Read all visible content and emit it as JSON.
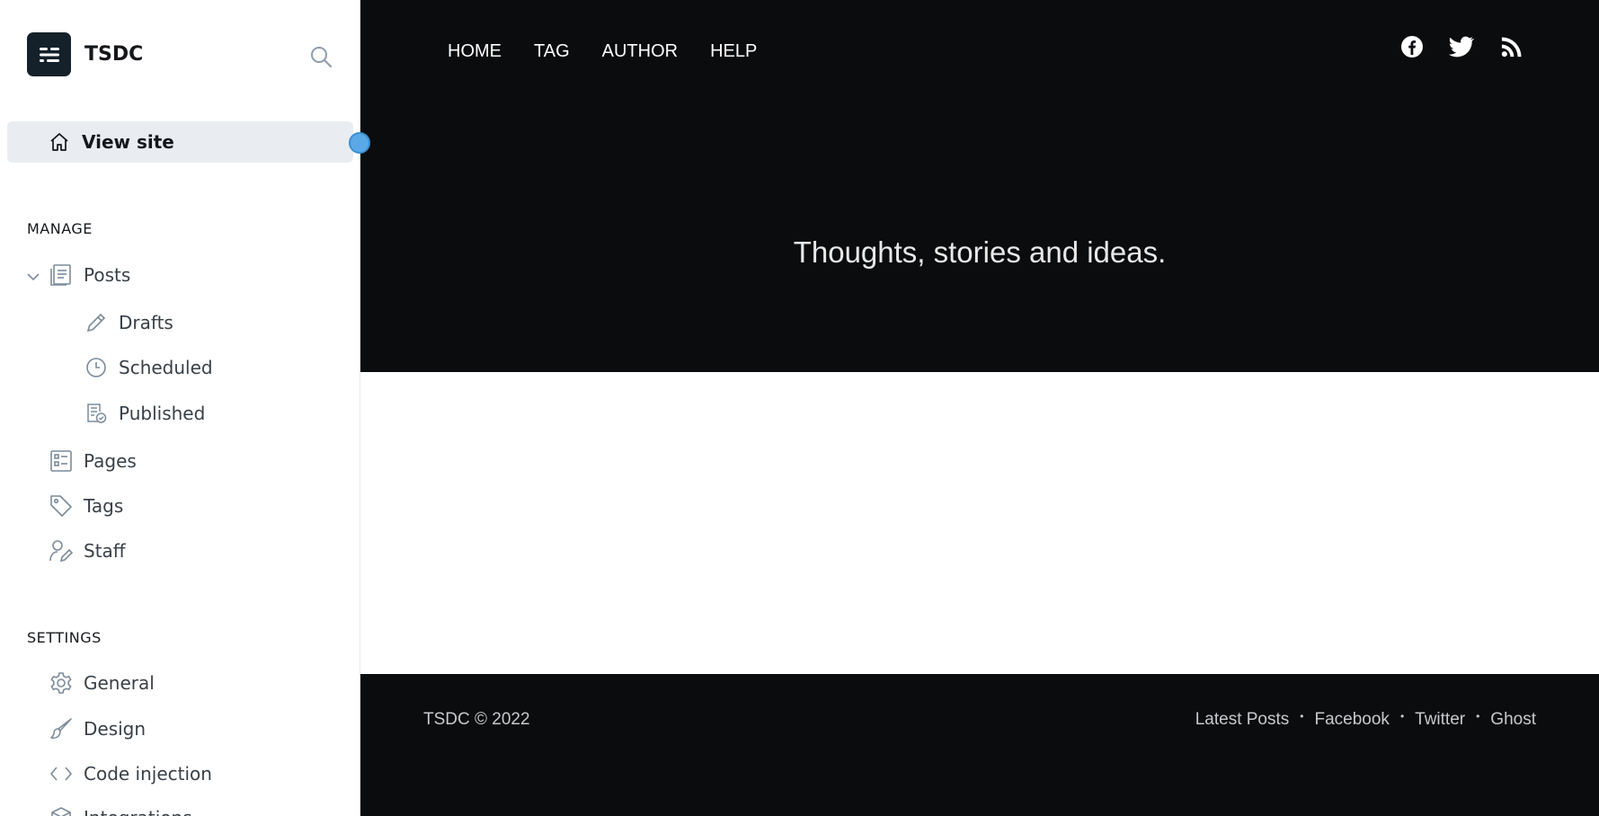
{
  "brand": {
    "name": "TSDC"
  },
  "sidebar": {
    "view_site": "View site",
    "manage_title": "MANAGE",
    "posts": "Posts",
    "drafts": "Drafts",
    "scheduled": "Scheduled",
    "published": "Published",
    "pages": "Pages",
    "tags": "Tags",
    "staff": "Staff",
    "settings_title": "SETTINGS",
    "general": "General",
    "design": "Design",
    "code_injection": "Code injection",
    "integrations": "Integrations"
  },
  "site": {
    "nav": [
      "HOME",
      "TAG",
      "AUTHOR",
      "HELP"
    ],
    "social_icons": [
      "facebook-icon",
      "twitter-icon",
      "rss-icon"
    ],
    "tagline": "Thoughts, stories and ideas.",
    "footer": {
      "copyright": "TSDC © 2022",
      "links": [
        "Latest Posts",
        "Facebook",
        "Twitter",
        "Ghost"
      ]
    }
  },
  "colors": {
    "accent": "#5aa9e6",
    "hero_bg": "#0b0c0e",
    "active_bg": "#e9edf2"
  }
}
